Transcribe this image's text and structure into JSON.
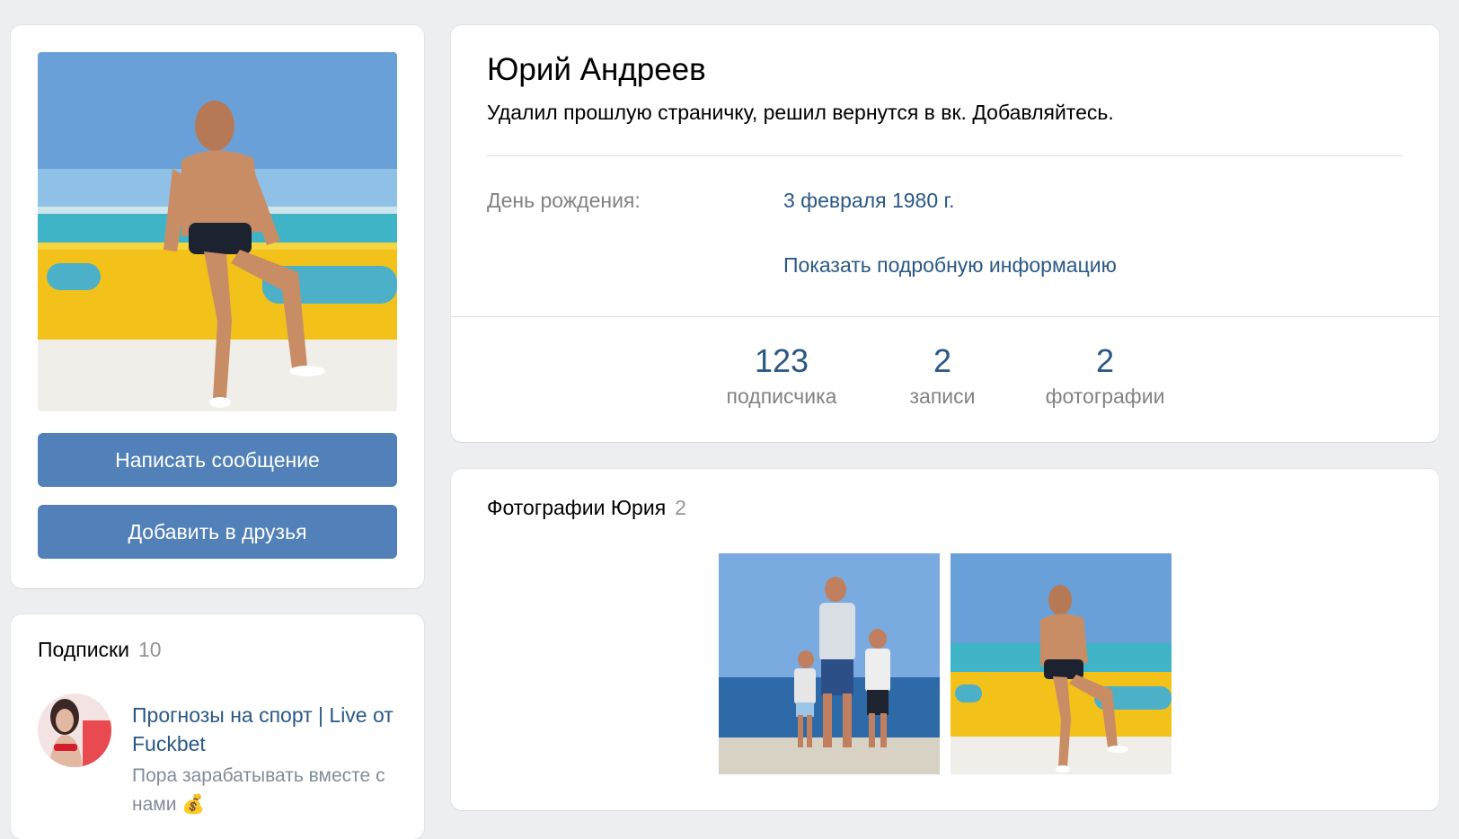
{
  "profile": {
    "name": "Юрий Андреев",
    "status": "Удалил прошлую страничку, решил вернутся в вк. Добавляйтесь.",
    "birthday_label": "День рождения:",
    "birthday_value": "3 февраля 1980 г.",
    "show_more": "Показать подробную информацию"
  },
  "actions": {
    "message_label": "Написать сообщение",
    "add_friend_label": "Добавить в друзья"
  },
  "counters": [
    {
      "value": "123",
      "label": "подписчика"
    },
    {
      "value": "2",
      "label": "записи"
    },
    {
      "value": "2",
      "label": "фотографии"
    }
  ],
  "photos": {
    "title": "Фотографии Юрия",
    "count": "2"
  },
  "subscriptions": {
    "title": "Подписки",
    "count": "10",
    "items": [
      {
        "name": "Прогнозы на спорт | Live от Fuckbet",
        "description": "Пора зарабатывать вместе с нами 💰"
      }
    ]
  },
  "colors": {
    "background": "#edeef0",
    "button": "#5181b8",
    "link": "#2a5885",
    "muted": "#828282"
  }
}
